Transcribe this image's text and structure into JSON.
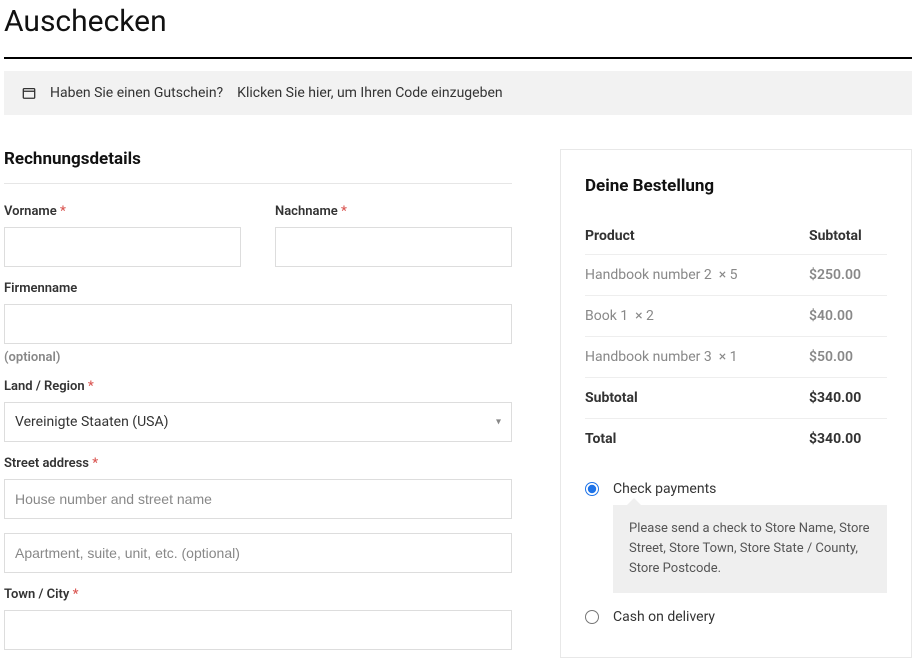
{
  "page_title": "Auschecken",
  "coupon": {
    "question": "Haben Sie einen Gutschein?",
    "link_text": "Klicken Sie hier, um Ihren Code einzugeben"
  },
  "billing": {
    "heading": "Rechnungsdetails",
    "first_name_label": "Vorname",
    "last_name_label": "Nachname",
    "company_label": "Firmenname",
    "optional_text": "(optional)",
    "country_label": "Land / Region",
    "country_value": "Vereinigte Staaten (USA)",
    "street_label": "Street address",
    "street1_placeholder": "House number and street name",
    "street2_placeholder": "Apartment, suite, unit, etc. (optional)",
    "city_label": "Town / City"
  },
  "order": {
    "heading": "Deine Bestellung",
    "col_product": "Product",
    "col_subtotal": "Subtotal",
    "items": [
      {
        "name": "Handbook number 2",
        "qty": "× 5",
        "subtotal": "$250.00"
      },
      {
        "name": "Book 1",
        "qty": "× 2",
        "subtotal": "$40.00"
      },
      {
        "name": "Handbook number 3",
        "qty": "× 1",
        "subtotal": "$50.00"
      }
    ],
    "subtotal_label": "Subtotal",
    "subtotal_value": "$340.00",
    "total_label": "Total",
    "total_value": "$340.00"
  },
  "payments": {
    "check_label": "Check payments",
    "check_desc": "Please send a check to Store Name, Store Street, Store Town, Store State / County, Store Postcode.",
    "cod_label": "Cash on delivery"
  }
}
